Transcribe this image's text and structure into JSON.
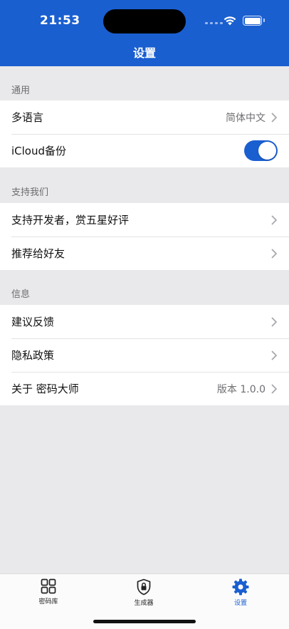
{
  "status_bar": {
    "time": "21:53"
  },
  "nav": {
    "title": "设置"
  },
  "sections": [
    {
      "header": "通用",
      "rows": [
        {
          "label": "多语言",
          "value": "简体中文"
        },
        {
          "label": "iCloud备份",
          "toggle_on": true
        }
      ]
    },
    {
      "header": "支持我们",
      "rows": [
        {
          "label": "支持开发者，赏五星好评"
        },
        {
          "label": "推荐给好友"
        }
      ]
    },
    {
      "header": "信息",
      "rows": [
        {
          "label": "建议反馈"
        },
        {
          "label": "隐私政策"
        },
        {
          "label": "关于 密码大师",
          "value": "版本 1.0.0"
        }
      ]
    }
  ],
  "tabbar": {
    "items": [
      {
        "label": "密码库",
        "icon": "grid-icon"
      },
      {
        "label": "生成器",
        "icon": "shield-lock-icon"
      },
      {
        "label": "设置",
        "icon": "gear-icon",
        "active": true
      }
    ]
  },
  "colors": {
    "accent": "#1a5fd0",
    "background": "#e9e9eb"
  }
}
